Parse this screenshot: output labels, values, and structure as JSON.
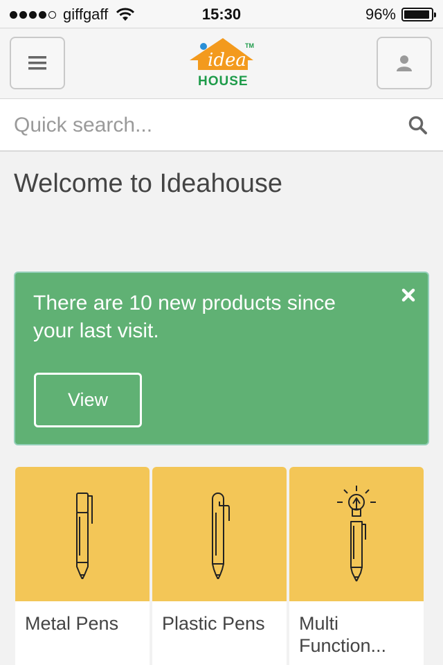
{
  "status_bar": {
    "carrier": "giffgaff",
    "time": "15:30",
    "battery_percent": "96%",
    "signal_bars": 4,
    "battery_level": 0.96
  },
  "header": {
    "menu_icon": "hamburger-icon",
    "user_icon": "user-icon",
    "logo_text": "idea",
    "logo_subtext": "HOUSE",
    "logo_tm": "TM"
  },
  "search": {
    "placeholder": "Quick search...",
    "icon": "search-icon"
  },
  "welcome_title": "Welcome to Ideahouse",
  "alert": {
    "message": "There are 10 new products since your last visit.",
    "button_label": "View",
    "close_icon": "close-icon"
  },
  "products": [
    {
      "label": "Metal Pens",
      "icon": "metal-pen-icon"
    },
    {
      "label": "Plastic Pens",
      "icon": "plastic-pen-icon"
    },
    {
      "label": "Multi Function...",
      "icon": "multi-function-pen-icon"
    }
  ],
  "colors": {
    "alert_green": "#60b174",
    "card_yellow": "#f3c657",
    "logo_orange": "#f39a1d",
    "logo_green": "#1e9b4a"
  }
}
